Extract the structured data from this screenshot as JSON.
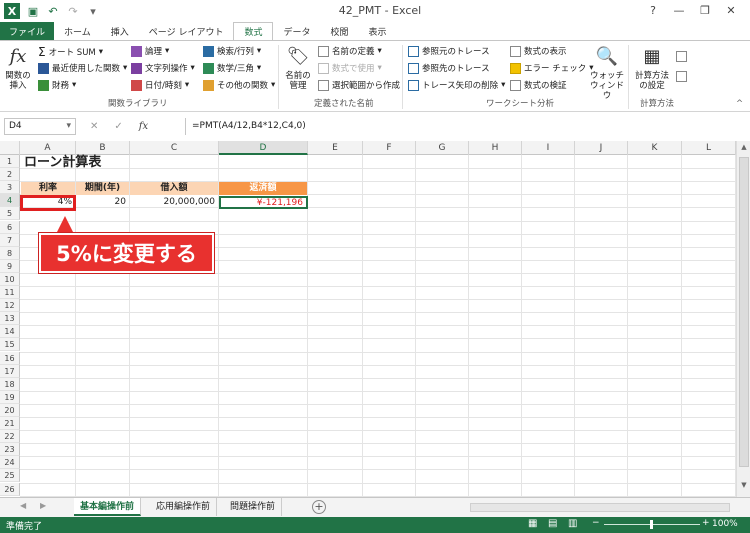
{
  "window": {
    "title": "42_PMT - Excel",
    "help": "?",
    "minimize": "—",
    "restore": "❐",
    "close": "✕"
  },
  "quick_access": {
    "save_icon": "save-icon",
    "undo_icon": "undo-icon",
    "redo_icon": "redo-icon"
  },
  "tabs": [
    "ファイル",
    "ホーム",
    "挿入",
    "ページ レイアウト",
    "数式",
    "データ",
    "校閲",
    "表示"
  ],
  "active_tab": "数式",
  "ribbon": {
    "insert_function": "関数の\n挿入",
    "library": {
      "autosum": "オート SUM",
      "recent": "最近使用した関数",
      "financial": "財務",
      "logical": "論理",
      "text": "文字列操作",
      "datetime": "日付/時刻",
      "lookup": "検索/行列",
      "math": "数学/三角",
      "more": "その他の関数",
      "label": "関数ライブラリ"
    },
    "names": {
      "name_manager": "名前の\n管理",
      "define_name": "名前の定義",
      "use_in_formula": "数式で使用",
      "create_from_selection": "選択範囲から作成",
      "label": "定義された名前"
    },
    "audit": {
      "trace_precedents": "参照元のトレース",
      "trace_dependents": "参照先のトレース",
      "remove_arrows": "トレース矢印の削除",
      "show_formulas": "数式の表示",
      "error_check": "エラー チェック",
      "evaluate": "数式の検証",
      "watch": "ウォッチ\nウィンドウ",
      "label": "ワークシート分析"
    },
    "calc": {
      "options": "計算方法\nの設定",
      "label": "計算方法"
    }
  },
  "formula_bar": {
    "name_box": "D4",
    "formula": "=PMT(A4/12,B4*12,C4,0)",
    "cancel": "✕",
    "enter": "✓",
    "fx": "fx"
  },
  "columns": [
    "A",
    "B",
    "C",
    "D",
    "E",
    "F",
    "G",
    "H",
    "I",
    "J",
    "K",
    "L"
  ],
  "rows": [
    "1",
    "2",
    "3",
    "4",
    "5",
    "6",
    "7",
    "8",
    "9",
    "10",
    "11",
    "12",
    "13",
    "14",
    "15",
    "16",
    "17",
    "18",
    "19",
    "20",
    "21",
    "22",
    "23",
    "24",
    "25",
    "26"
  ],
  "sheet": {
    "title": "ローン計算表",
    "headers": [
      "利率",
      "期間(年)",
      "借入額",
      "返済額"
    ],
    "values": [
      "4%",
      "20",
      "20,000,000",
      "¥-121,196"
    ]
  },
  "callout": "5%に変更する",
  "sheet_tabs": [
    "基本編操作前",
    "応用編操作前",
    "問題操作前"
  ],
  "active_sheet": "基本編操作前",
  "status": {
    "ready": "準備完了",
    "zoom": "100%"
  },
  "colors": {
    "excel_green": "#217346",
    "highlight_red": "#e02020",
    "header_orange": "#f79646",
    "header_peach": "#fcd5b4"
  }
}
